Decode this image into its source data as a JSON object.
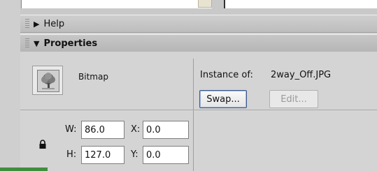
{
  "panels": {
    "help": {
      "title": "Help",
      "collapsed": true
    },
    "properties": {
      "title": "Properties",
      "collapsed": false,
      "symbol_type": "Bitmap",
      "instance_of_label": "Instance of:",
      "instance_of_value": "2way_Off.JPG",
      "swap_button": "Swap...",
      "edit_button": "Edit...",
      "fields": {
        "w_label": "W:",
        "w_value": "86.0",
        "h_label": "H:",
        "h_value": "127.0",
        "x_label": "X:",
        "x_value": "0.0",
        "y_label": "Y:",
        "y_value": "0.0"
      }
    }
  },
  "icons": {
    "help_toggle": "triangle-right-icon",
    "properties_toggle": "triangle-down-icon",
    "lock": "lock-icon",
    "bitmap_preview": "tree-bitmap-icon"
  },
  "colors": {
    "panel_bg": "#d4d4d4",
    "header_bg": "#bdbdbd",
    "focus_button_border": "#3f5a8a"
  }
}
